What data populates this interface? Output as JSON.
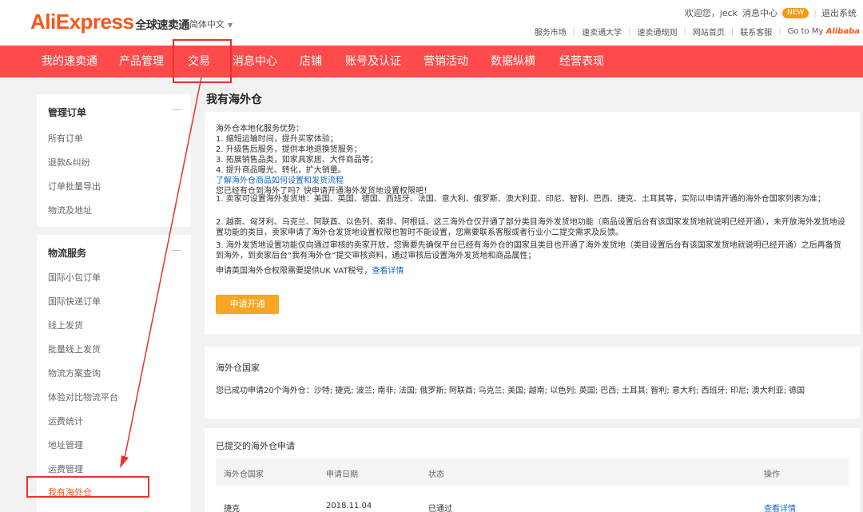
{
  "header": {
    "logo": "AliExpress",
    "logo_cn": "全球速卖通",
    "language": "简体中文",
    "greeting": "欢迎您，jeck",
    "message_center": "消息中心",
    "badge": "NEW",
    "logout": "退出系统",
    "links": [
      "服务市场",
      "速卖通大学",
      "速卖通规则",
      "网站首页",
      "联系客服"
    ],
    "goto_label": "Go to My",
    "goto_brand": "Alibaba"
  },
  "nav": {
    "items": [
      "我的速卖通",
      "产品管理",
      "交易",
      "消息中心",
      "店铺",
      "账号及认证",
      "营销活动",
      "数据纵横",
      "经营表现"
    ]
  },
  "sidebar": {
    "group1_title": "管理订单",
    "group1_items": [
      "所有订单",
      "退款&纠纷",
      "订单批量导出",
      "物流及地址"
    ],
    "group2_title": "物流服务",
    "group2_items": [
      "国际小包订单",
      "国际快递订单",
      "线上发货",
      "批量线上发货",
      "物流方案查询",
      "体验对比物流平台",
      "运费统计",
      "地址管理",
      "运费管理",
      "我有海外仓"
    ],
    "toggle": "—"
  },
  "main": {
    "title": "我有海外仓",
    "card1": {
      "lines": [
        "海外仓本地化服务优势：",
        "1. 缩短运输时间，提升买家体验；",
        "2. 升级售后服务，提供本地退换货服务；",
        "3. 拓展销售品类，如家具家居、大件商品等；",
        "4. 提升商品曝光、转化，扩大销量。"
      ],
      "link1": "了解海外仓商品如何设置和发货流程",
      "lines2": [
        "您已经有仓到海外了吗？快申请开通海外发货地设置权限吧！",
        "1. 卖家可设置海外发货地：美国、英国、德国、西班牙、法国、意大利、俄罗斯、澳大利亚、印尼、智利、巴西、捷克、土耳其等，实际以申请开通的海外仓国家列表为准；",
        "2. 越南、匈牙利、乌克兰、阿联酋、以色列、南非、阿根廷、这三海外仓仅开通了部分类目海外发货地功能（商品设置后台有该国家发货地就说明已经开通），未开放海外发货地设置功能的类目，卖家申请了海外仓发货地设置权限也暂时不能设置，您需要联系客服或者行业小二提交需求及反馈。",
        "3. 海外发货地设置功能仅向通过审核的卖家开放，您需要先确保平台已经有海外仓的国家且类目也开通了海外发货地（类目设置后台有该国家发货地就说明已经开通）之后再备货到海外，到卖家后台“我有海外仓”提交审核资料，通过审核后设置海外发货地和商品属性；"
      ],
      "last_line": "申请英国海外仓权限需要提供UK VAT税号，",
      "last_link": "查看详情",
      "apply_button": "申请开通"
    },
    "card2": {
      "title": "海外仓国家",
      "text": "您已成功申请20个海外仓：沙特; 捷克; 波兰; 南非; 法国; 俄罗斯; 阿联酋; 乌克兰; 美国; 越南; 以色列; 英国; 巴西; 土耳其; 智利; 意大利; 西班牙; 印尼; 澳大利亚; 德国"
    },
    "card3": {
      "title": "已提交的海外仓申请",
      "headers": [
        "海外仓国家",
        "申请日期",
        "状态",
        "操作"
      ],
      "row": {
        "country": "捷克",
        "date": "2018.11.04",
        "status": "已通过",
        "action": "查看详情"
      }
    }
  }
}
